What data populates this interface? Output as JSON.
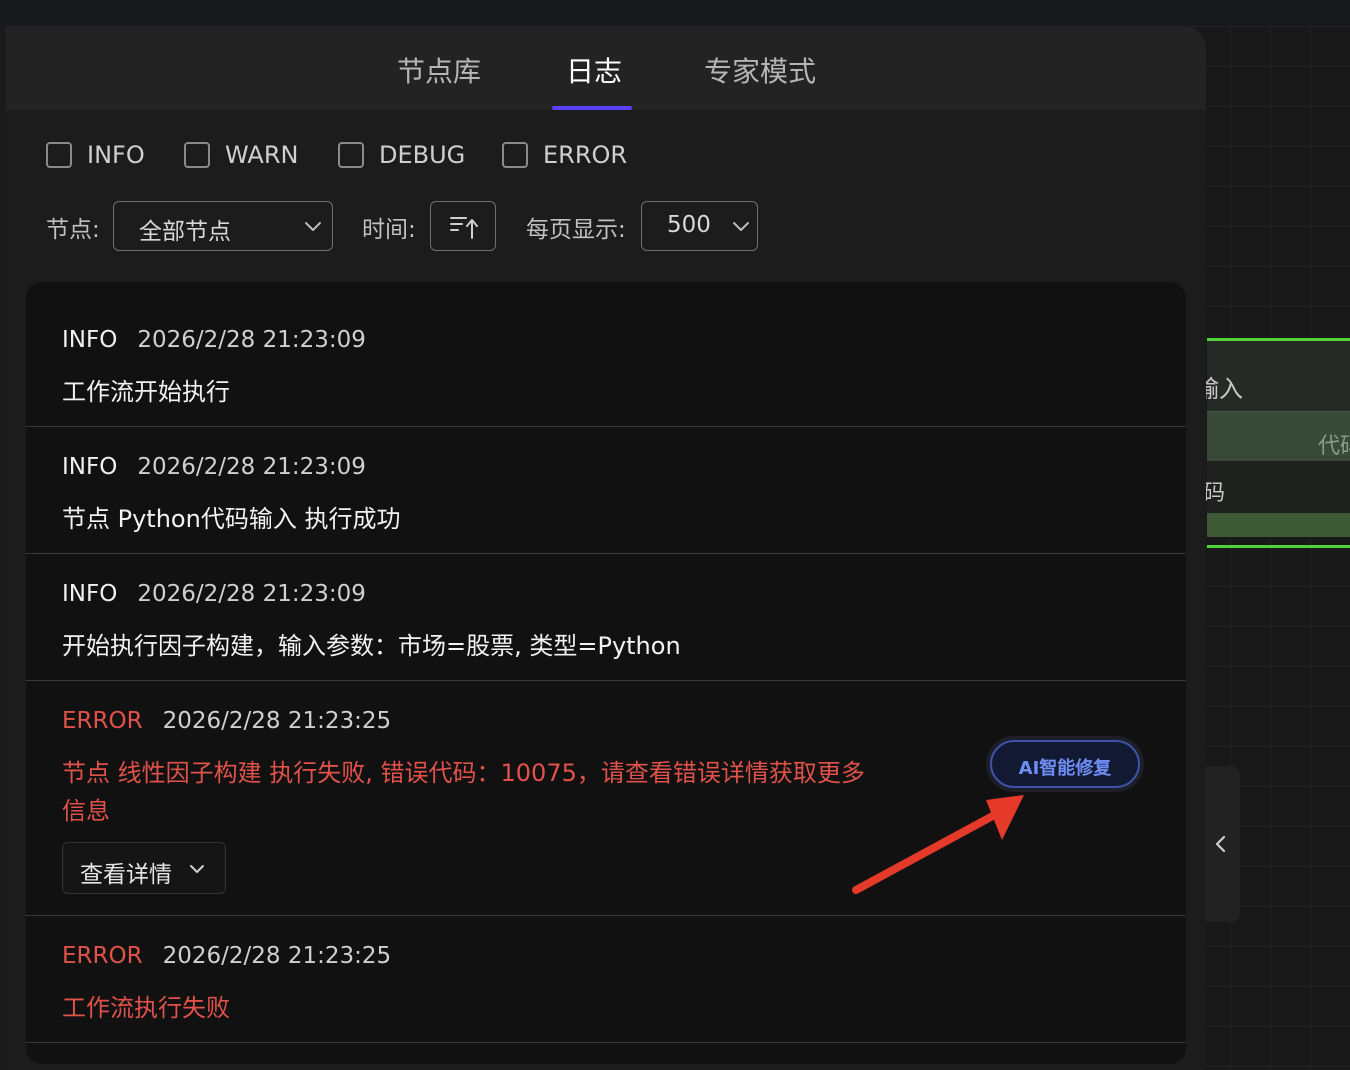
{
  "tabs": [
    {
      "label": "节点库"
    },
    {
      "label": "日志"
    },
    {
      "label": "专家模式"
    }
  ],
  "active_tab": "日志",
  "filters": {
    "levels": [
      {
        "label": "INFO",
        "checked": false
      },
      {
        "label": "WARN",
        "checked": false
      },
      {
        "label": "DEBUG",
        "checked": false
      },
      {
        "label": "ERROR",
        "checked": false
      }
    ],
    "node_label": "节点:",
    "node_value": "全部节点",
    "time_label": "时间:",
    "page_size_label": "每页显示:",
    "page_size_value": "500"
  },
  "logs": [
    {
      "level": "INFO",
      "timestamp": "2026/2/28 21:23:09",
      "message": "工作流开始执行"
    },
    {
      "level": "INFO",
      "timestamp": "2026/2/28 21:23:09",
      "message": "节点 Python代码输入 执行成功"
    },
    {
      "level": "INFO",
      "timestamp": "2026/2/28 21:23:09",
      "message": "开始执行因子构建，输入参数：市场=股票, 类型=Python"
    },
    {
      "level": "ERROR",
      "timestamp": "2026/2/28 21:23:25",
      "message_line1": "节点 线性因子构建 执行失败, 错误代码：10075，请查看错误详情获取更多",
      "message_line2": "信息",
      "ai_fix_label": "AI智能修复",
      "detail_label": "查看详情"
    },
    {
      "level": "ERROR",
      "timestamp": "2026/2/28 21:23:25",
      "message": "工作流执行失败"
    }
  ],
  "canvas_node": {
    "title": "输入",
    "port_label": "代码",
    "body_text": "码"
  },
  "colors": {
    "accent": "#5a3ff5",
    "error": "#e0524a",
    "ai_button_text": "#6f8ef5",
    "node_border": "#4fd23a",
    "annotation_arrow": "#e53a2a"
  }
}
